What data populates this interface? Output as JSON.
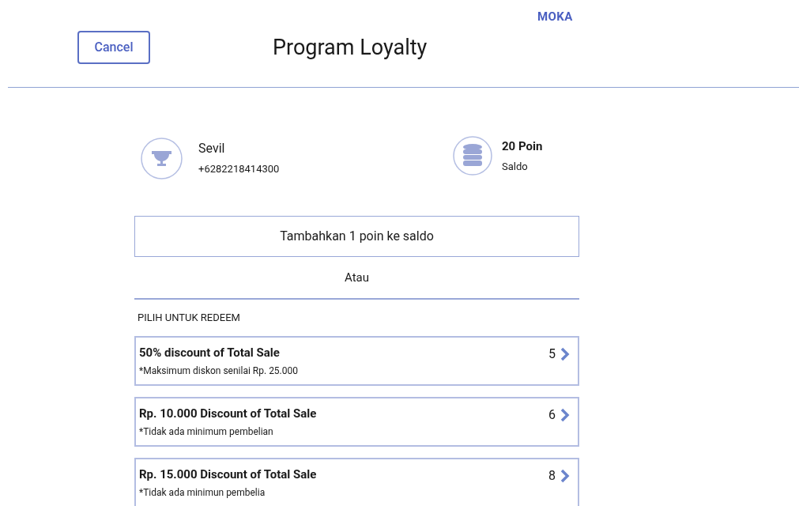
{
  "logo": "MOKA",
  "cancel_button": "Cancel",
  "title": "Program Loyalty",
  "customer": {
    "name": "Sevil",
    "phone": "+6282218414300"
  },
  "balance": {
    "points": "20 Poin",
    "label": "Saldo"
  },
  "add_button": "Tambahkan 1 poin ke saldo",
  "separator": "Atau",
  "section_title": "PILIH UNTUK REDEEM",
  "rewards": [
    {
      "title": "50% discount of Total Sale",
      "note": "*Maksimum diskon senilai Rp. 25.000",
      "cost": "5"
    },
    {
      "title": "Rp. 10.000 Discount of Total Sale",
      "note": "*Tidak ada minimum pembelian",
      "cost": "6"
    },
    {
      "title": "Rp. 15.000 Discount of Total Sale",
      "note": "*Tidak ada minimun pembelia",
      "cost": "8"
    }
  ]
}
